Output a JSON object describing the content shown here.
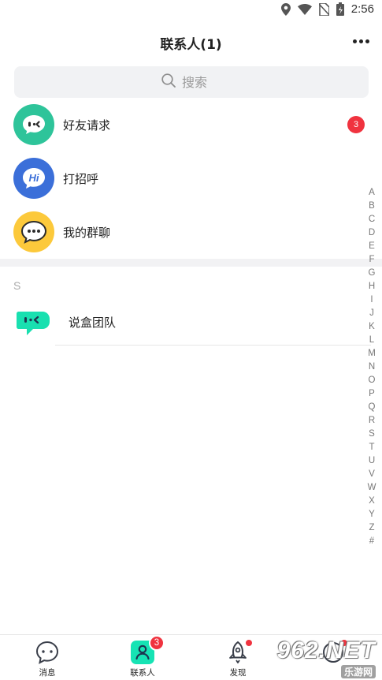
{
  "status_bar": {
    "time": "2:56",
    "icons": [
      "location-icon",
      "wifi-icon",
      "no-sim-icon",
      "battery-icon"
    ]
  },
  "header": {
    "title": "联系人(1)",
    "more_icon": "more-dots-icon"
  },
  "search": {
    "placeholder": "搜索",
    "icon": "search-icon"
  },
  "entries": [
    {
      "label": "好友请求",
      "icon": "friend-request-icon",
      "color": "#2ec49a",
      "badge": "3"
    },
    {
      "label": "打招呼",
      "icon": "hi-bubble-icon",
      "color": "#3b6fd9"
    },
    {
      "label": "我的群聊",
      "icon": "group-chat-icon",
      "color": "#fcc93b"
    }
  ],
  "contacts": {
    "section": "S",
    "items": [
      {
        "name": "说盒团队",
        "icon": "shuohe-logo-icon",
        "color": "#19e0b0"
      }
    ]
  },
  "alpha_index": [
    "A",
    "B",
    "C",
    "D",
    "E",
    "F",
    "G",
    "H",
    "I",
    "J",
    "K",
    "L",
    "M",
    "N",
    "O",
    "P",
    "Q",
    "R",
    "S",
    "T",
    "U",
    "V",
    "W",
    "X",
    "Y",
    "Z",
    "#"
  ],
  "tabbar": {
    "tabs": [
      {
        "label": "消息",
        "icon": "message-icon"
      },
      {
        "label": "联系人",
        "icon": "contacts-icon",
        "badge": "3",
        "active": true,
        "active_color": "#16e3b4"
      },
      {
        "label": "发现",
        "icon": "rocket-icon",
        "dot": true
      },
      {
        "label": "",
        "icon": "profile-icon",
        "dot": true
      }
    ]
  },
  "watermark": {
    "brand": "962.NET",
    "sub": "乐游网"
  }
}
